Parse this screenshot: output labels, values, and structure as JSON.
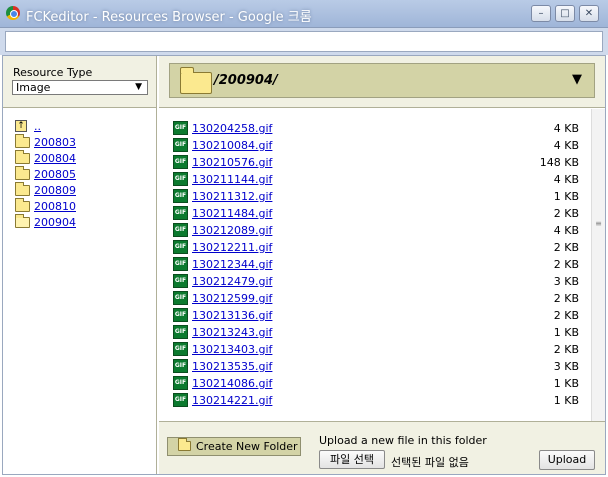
{
  "window": {
    "title": "FCKeditor - Resources Browser - Google 크롬",
    "min": "–",
    "max": "□",
    "close": "✕"
  },
  "resource_type": {
    "label": "Resource Type",
    "selected": "Image"
  },
  "folders": {
    "up": "..",
    "items": [
      "200803",
      "200804",
      "200805",
      "200809",
      "200810",
      "200904"
    ],
    "current": "200904"
  },
  "current_path": "/200904/",
  "files": [
    {
      "name": "130204258.gif",
      "size": "4 KB"
    },
    {
      "name": "130210084.gif",
      "size": "4 KB"
    },
    {
      "name": "130210576.gif",
      "size": "148 KB"
    },
    {
      "name": "130211144.gif",
      "size": "4 KB"
    },
    {
      "name": "130211312.gif",
      "size": "1 KB"
    },
    {
      "name": "130211484.gif",
      "size": "2 KB"
    },
    {
      "name": "130212089.gif",
      "size": "4 KB"
    },
    {
      "name": "130212211.gif",
      "size": "2 KB"
    },
    {
      "name": "130212344.gif",
      "size": "2 KB"
    },
    {
      "name": "130212479.gif",
      "size": "3 KB"
    },
    {
      "name": "130212599.gif",
      "size": "2 KB"
    },
    {
      "name": "130213136.gif",
      "size": "2 KB"
    },
    {
      "name": "130213243.gif",
      "size": "1 KB"
    },
    {
      "name": "130213403.gif",
      "size": "2 KB"
    },
    {
      "name": "130213535.gif",
      "size": "3 KB"
    },
    {
      "name": "130214086.gif",
      "size": "1 KB"
    },
    {
      "name": "130214221.gif",
      "size": "1 KB"
    }
  ],
  "file_icon_text": "GIF",
  "bottom": {
    "new_folder": "Create New Folder",
    "upload_label": "Upload a new file in this folder",
    "choose_file": "파일 선택",
    "no_file": "선택된 파일 없음",
    "upload": "Upload"
  }
}
